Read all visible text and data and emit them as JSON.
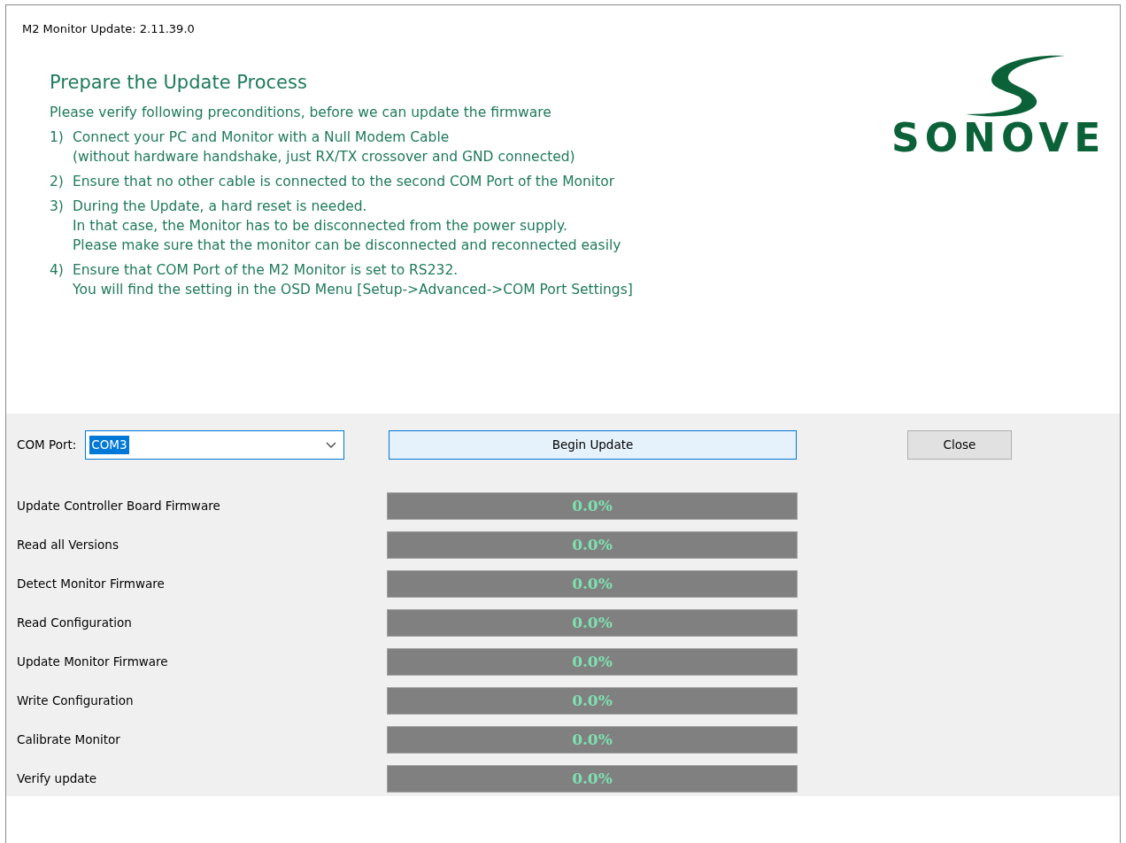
{
  "window": {
    "title": "M2 Monitor Update: 2.11.39.0"
  },
  "heading": "Prepare the Update Process",
  "intro": "Please verify following preconditions, before we can update the firmware",
  "steps": [
    {
      "number": "1)",
      "lines": [
        "Connect your PC and Monitor with a Null Modem Cable",
        "(without hardware handshake, just RX/TX crossover and GND connected)"
      ]
    },
    {
      "number": "2)",
      "lines": [
        "Ensure that no other cable is connected to the second COM Port of the Monitor"
      ]
    },
    {
      "number": "3)",
      "lines": [
        "During the Update, a hard reset is needed.",
        "In that case, the Monitor has to be disconnected from the power supply.",
        "Please make sure that the monitor can be disconnected and reconnected easily"
      ]
    },
    {
      "number": "4)",
      "lines": [
        "Ensure that COM Port of the M2 Monitor is set to RS232.",
        "You will find the setting in the OSD Menu [Setup->Advanced->COM Port Settings]"
      ]
    }
  ],
  "logo": {
    "text": "SONOVE"
  },
  "com_port": {
    "label": "COM Port:",
    "value": "COM3"
  },
  "buttons": [
    {
      "label": "Begin Update",
      "focused": true
    },
    {
      "label": "Close",
      "focused": false
    }
  ],
  "tasks": [
    {
      "label": "Update Controller Board Firmware",
      "level": 0,
      "reading": "0.0%"
    },
    {
      "label": "Read all Versions",
      "level": 0,
      "reading": "0.0%"
    },
    {
      "label": "Detect Monitor Firmware",
      "level": 0,
      "reading": "0.0%"
    },
    {
      "label": "Read Configuration",
      "level": 0,
      "reading": "0.0%"
    },
    {
      "label": "Update Monitor Firmware",
      "level": 0,
      "reading": "0.0%"
    },
    {
      "label": "Write Configuration",
      "level": 0,
      "reading": "0.0%"
    },
    {
      "label": "Calibrate Monitor",
      "level": 0,
      "reading": "0.0%"
    },
    {
      "label": "Verify update",
      "level": 0,
      "reading": "0.0%"
    }
  ]
}
